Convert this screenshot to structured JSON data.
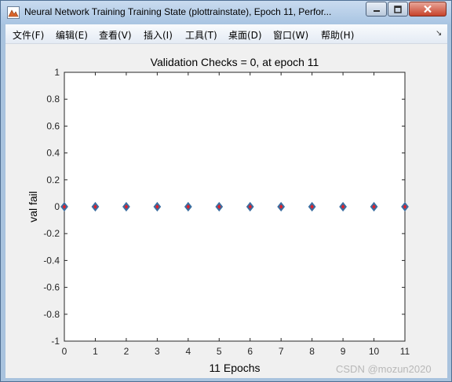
{
  "window": {
    "title": "Neural Network Training Training State (plottrainstate), Epoch 11, Perfor...",
    "icon": "matlab-figure-icon",
    "controls": {
      "minimize": "minimize-icon",
      "maximize": "maximize-icon",
      "close": "close-icon"
    }
  },
  "menu": {
    "items": [
      {
        "label": "文件(F)"
      },
      {
        "label": "编辑(E)"
      },
      {
        "label": "查看(V)"
      },
      {
        "label": "插入(I)"
      },
      {
        "label": "工具(T)"
      },
      {
        "label": "桌面(D)"
      },
      {
        "label": "窗口(W)"
      },
      {
        "label": "帮助(H)"
      }
    ],
    "overflow_icon": "dock-arrow-icon"
  },
  "chart_data": {
    "type": "scatter",
    "title": "Validation Checks = 0, at epoch 11",
    "xlabel": "11 Epochs",
    "ylabel": "val fail",
    "xlim": [
      0,
      11
    ],
    "ylim": [
      -1,
      1
    ],
    "xticks": [
      0,
      1,
      2,
      3,
      4,
      5,
      6,
      7,
      8,
      9,
      10,
      11
    ],
    "yticks": [
      -1,
      -0.8,
      -0.6,
      -0.4,
      -0.2,
      0,
      0.2,
      0.4,
      0.6,
      0.8,
      1
    ],
    "grid": false,
    "series": [
      {
        "x": [
          0,
          1,
          2,
          3,
          4,
          5,
          6,
          7,
          8,
          9,
          10,
          11
        ],
        "values": [
          0,
          0,
          0,
          0,
          0,
          0,
          0,
          0,
          0,
          0,
          0,
          0
        ],
        "marker": "diamond",
        "edge_color": "#3b6ea0",
        "face_color": "#e0202a"
      }
    ]
  },
  "watermark": "CSDN @mozun2020"
}
